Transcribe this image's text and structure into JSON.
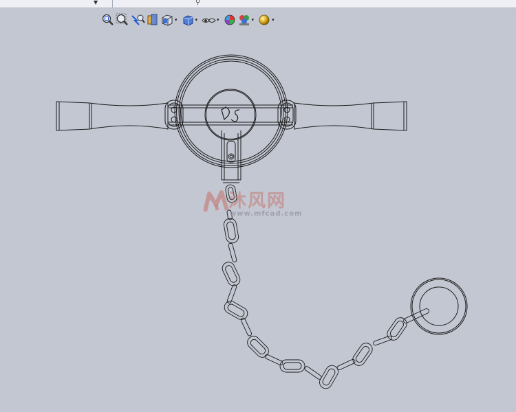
{
  "topbar": {
    "dropdown_glyph": "▼",
    "pin_glyph": "⚲"
  },
  "toolbar": {
    "buttons": [
      {
        "name": "zoom-to-fit-icon",
        "has_dropdown": false
      },
      {
        "name": "zoom-to-area-icon",
        "has_dropdown": false
      },
      {
        "name": "previous-view-icon",
        "has_dropdown": false
      },
      {
        "name": "section-view-icon",
        "has_dropdown": false
      },
      {
        "name": "view-orientation-icon",
        "has_dropdown": true
      },
      {
        "name": "display-style-icon",
        "has_dropdown": true
      },
      {
        "name": "hide-show-items-icon",
        "has_dropdown": true
      },
      {
        "name": "edit-appearance-icon",
        "has_dropdown": false
      },
      {
        "name": "apply-scene-icon",
        "has_dropdown": true
      },
      {
        "name": "view-settings-icon",
        "has_dropdown": true
      }
    ],
    "dropdown_glyph": "▾"
  },
  "model": {
    "description_hidden": "",
    "badge_text": "DS",
    "chain_links": 15,
    "colors": {
      "line": "#1a1a1a",
      "background": "#c3c7d2"
    }
  },
  "watermark": {
    "chinese": "沐风网",
    "url": "www.mfcad.com",
    "color": "#c3766f"
  }
}
